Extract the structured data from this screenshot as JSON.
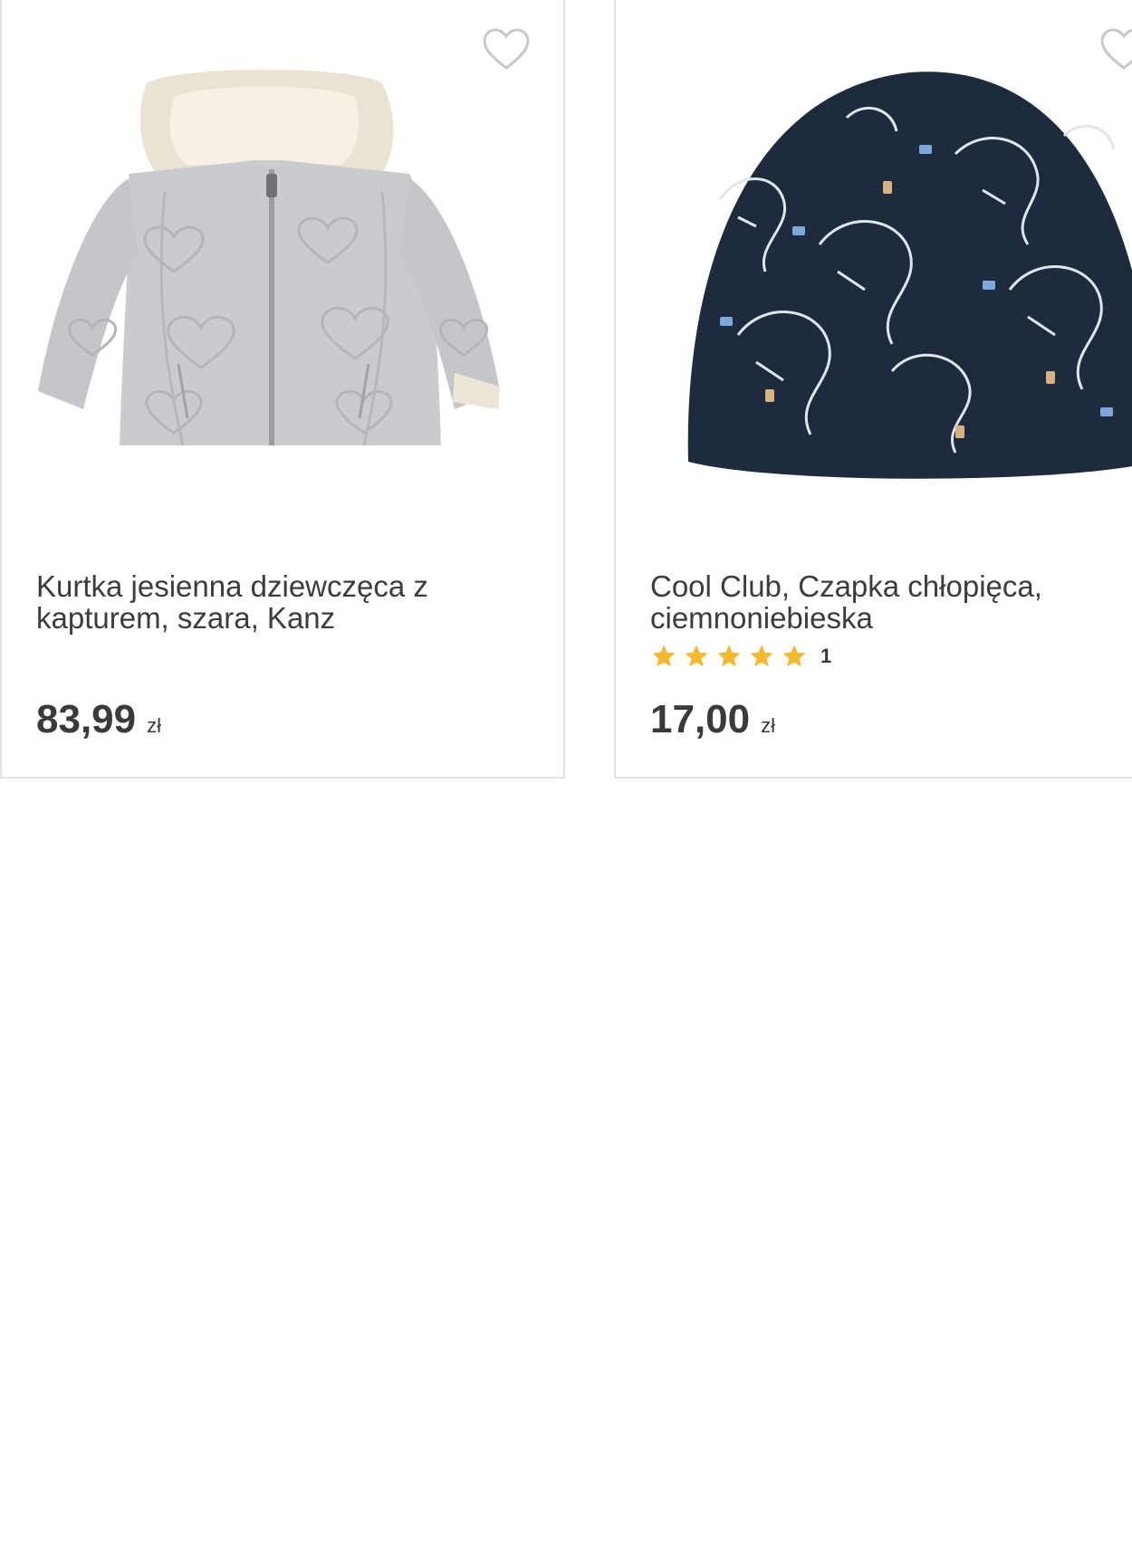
{
  "products": [
    {
      "title": "Kurtka jesienna dziewczęca z kapturem, szara, Kanz",
      "image": "grey-quilted-hooded-jacket",
      "price": "83,99",
      "currency": "zł",
      "favorite_icon": "heart-outline-icon"
    },
    {
      "title": "Cool Club, Czapka chłopięca, ciemnoniebieska",
      "image": "navy-beanie-dinosaur-print",
      "rating": {
        "stars": 5,
        "count": "1"
      },
      "price": "17,00",
      "currency": "zł",
      "favorite_icon": "heart-outline-icon"
    }
  ],
  "colors": {
    "star": "#f5b82e",
    "text": "#3a3a3a",
    "border": "#e3e3e3",
    "heart": "#c8c8c8",
    "beanie": "#1e2a3d",
    "jacket": "#c9cbce"
  }
}
